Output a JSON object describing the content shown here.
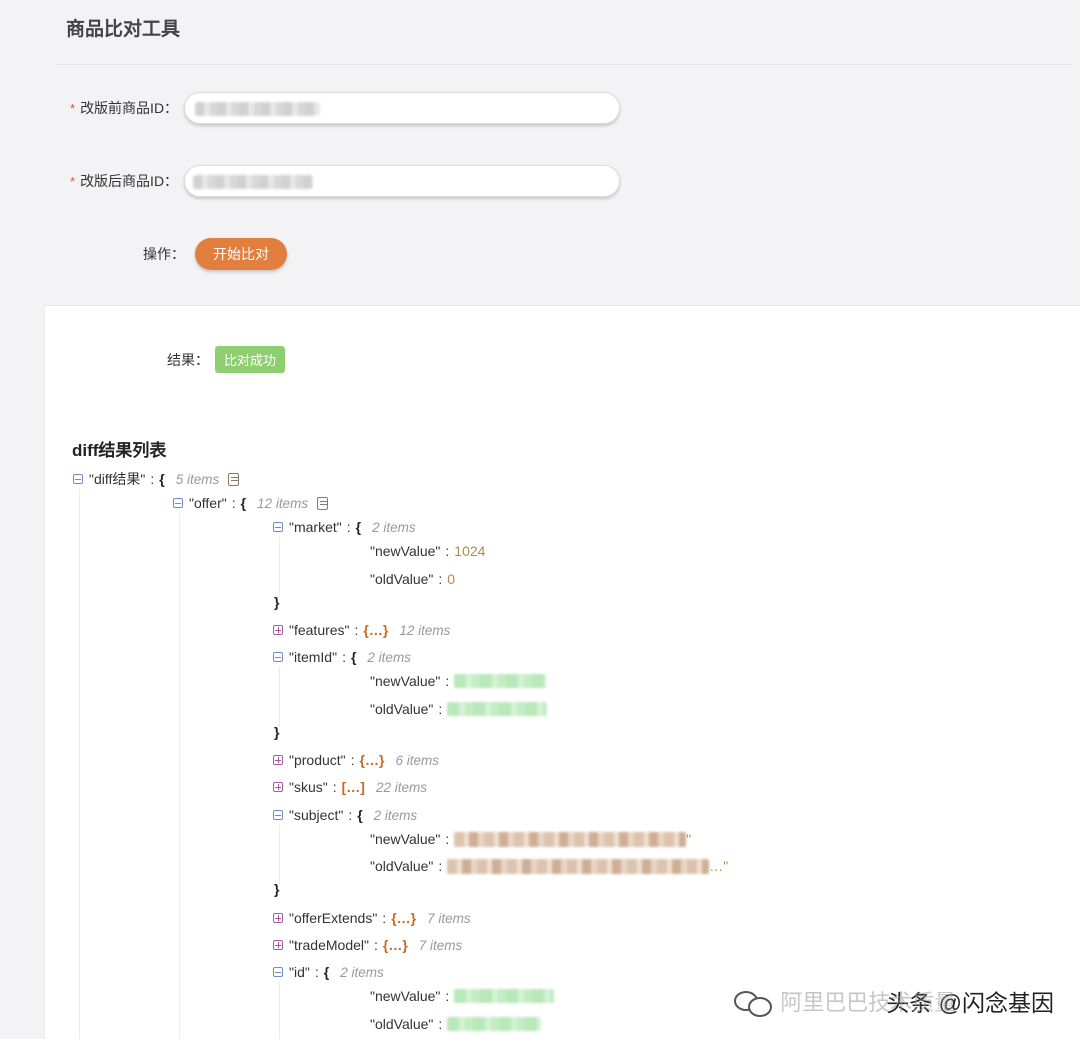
{
  "page": {
    "title": "商品比对工具"
  },
  "form": {
    "before_label": "改版前商品ID：",
    "after_label": "改版后商品ID：",
    "required_mark": "*",
    "action_label": "操作：",
    "start_button": "开始比对"
  },
  "result": {
    "label": "结果：",
    "badge": "比对成功"
  },
  "diff": {
    "title": "diff结果列表",
    "root_key": "\"diff结果\"",
    "root_count": "5 items",
    "offer_key": "\"offer\"",
    "offer_count": "12 items",
    "market_key": "\"market\"",
    "market_count": "2 items",
    "new_value_key": "\"newValue\"",
    "old_value_key": "\"oldValue\"",
    "market_new": "1024",
    "market_old": "0",
    "features_key": "\"features\"",
    "features_count": "12 items",
    "itemid_key": "\"itemId\"",
    "itemid_count": "2 items",
    "product_key": "\"product\"",
    "product_count": "6 items",
    "skus_key": "\"skus\"",
    "skus_count": "22 items",
    "subject_key": "\"subject\"",
    "subject_count": "2 items",
    "subject_new_tail": "\"",
    "subject_old_tail": "…\"",
    "offerextends_key": "\"offerExtends\"",
    "offerextends_count": "7 items",
    "trademodel_key": "\"tradeModel\"",
    "trademodel_count": "7 items",
    "id_key": "\"id\"",
    "id_count": "2 items",
    "colon": ":",
    "open_brace": "{",
    "close_brace": "}",
    "collapsed_obj": "{…}",
    "collapsed_arr": "[…]"
  },
  "watermark": {
    "faded_text": "阿里巴巴技术质量",
    "text": "头条 @闪念基因"
  },
  "colors": {
    "accent": "#e27f3f",
    "success": "#8fcf72",
    "required": "#e2503a"
  }
}
